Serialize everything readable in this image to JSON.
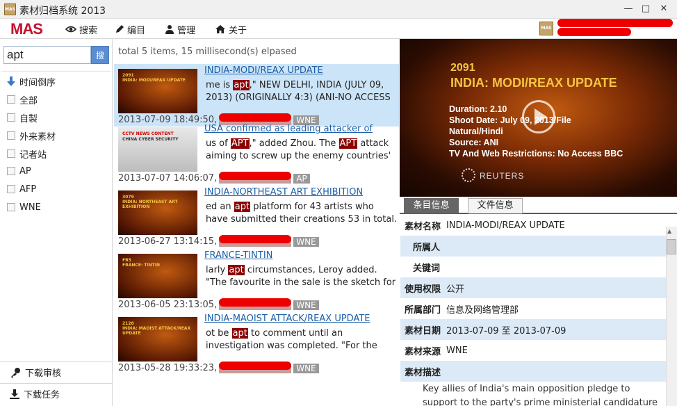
{
  "window": {
    "title": "素材归档系统 2013",
    "icon_text": "MAS",
    "min": "—",
    "max": "□",
    "close": "✕"
  },
  "toolbar": {
    "logo": "MAS",
    "items": [
      {
        "label": "搜索",
        "icon": "eye-icon"
      },
      {
        "label": "编目",
        "icon": "pen-icon"
      },
      {
        "label": "管理",
        "icon": "user-icon"
      },
      {
        "label": "关于",
        "icon": "home-icon"
      }
    ],
    "user_icon_text": "MAS"
  },
  "search": {
    "value": "apt",
    "button": "搜"
  },
  "filters": {
    "sort_label": "时间倒序",
    "items": [
      "全部",
      "自製",
      "外来素材",
      "记者站",
      "AP",
      "AFP",
      "WNE"
    ]
  },
  "bottom": {
    "review": "下载审核",
    "tasks": "下载任务"
  },
  "results": {
    "summary": "total 5 items, 15 millisecond(s) elpased",
    "items": [
      {
        "title": "INDIA-MODI/REAX UPDATE",
        "pre": "me is ",
        "hl": "apt",
        "post": ",\" NEW DELHI, INDIA (JULY 09, 2013) (ORIGINALLY 4:3) (ANI-NO ACCESS",
        "date": "2013-07-09 18:49:50,",
        "source": "WNE",
        "thumb_num": "2091",
        "thumb_title": "INDIA: MODI/REAX UPDATE",
        "selected": true
      },
      {
        "title": "USA confirmed as leading attacker of",
        "pre": "us of ",
        "hl": "APT",
        "post": ",\" added Zhou. The ",
        "hl2": "APT",
        "post2": " attack aiming to screw up the enemy countries'",
        "date": "2013-07-07 14:06:07,",
        "source": "AP",
        "thumb_num": "CCTV NEWS CONTENT",
        "thumb_title": "CHINA CYBER SECURITY",
        "selected": false
      },
      {
        "title": "INDIA-NORTHEAST ART EXHIBITION",
        "pre": "ed an ",
        "hl": "apt",
        "post": " platform for 43 artists who have submitted their creations 53 in total.",
        "date": "2013-06-27 13:14:15,",
        "source": "WNE",
        "thumb_num": "3079",
        "thumb_title": "INDIA: NORTHEAST ART EXHIBITION",
        "selected": false
      },
      {
        "title": "FRANCE-TINTIN",
        "pre": "larly ",
        "hl": "apt",
        "post": " circumstances, Leroy added. \"The favourite in the sale is the sketch for 'Tintin",
        "date": "2013-06-05 23:13:05,",
        "source": "WNE",
        "thumb_num": "FR5",
        "thumb_title": "FRANCE: TINTIN",
        "selected": false
      },
      {
        "title": "INDIA-MAOIST ATTACK/REAX UPDATE",
        "pre": "ot be ",
        "hl": "apt",
        "post": " to comment until an investigation was completed. \"For the first time the",
        "date": "2013-05-28 19:33:23,",
        "source": "WNE",
        "thumb_num": "2128",
        "thumb_title": "INDIA: MAOIST ATTACK/REAX UPDATE",
        "selected": false
      }
    ]
  },
  "video": {
    "num": "2091",
    "title": "INDIA: MODI/REAX UPDATE",
    "lines": [
      "Duration: 2.10",
      "Shoot Date: July 09, 2013/File",
      "Natural/Hindi",
      "Source: ANI",
      "TV And Web Restrictions: No Access BBC"
    ],
    "brand": "REUTERS"
  },
  "tabs": [
    "条目信息",
    "文件信息"
  ],
  "details": [
    {
      "label": "素材名称",
      "value": "INDIA-MODI/REAX UPDATE"
    },
    {
      "label": "所属人",
      "value": ""
    },
    {
      "label": "关键词",
      "value": ""
    },
    {
      "label": "使用权限",
      "value": "公开"
    },
    {
      "label": "所属部门",
      "value": "信息及网络管理部"
    },
    {
      "label": "素材日期",
      "value": "2013-07-09 至 2013-07-09"
    },
    {
      "label": "素材来源",
      "value": "WNE"
    },
    {
      "label": "素材描述",
      "value": ""
    }
  ],
  "description": "Key allies of India's main opposition pledge to support to the party's prime ministerial candidature even as",
  "colors": {
    "accent": "#5b8ed1",
    "logo": "#c8102e",
    "selected_row": "#cce4f7",
    "highlight": "#8b0000"
  }
}
